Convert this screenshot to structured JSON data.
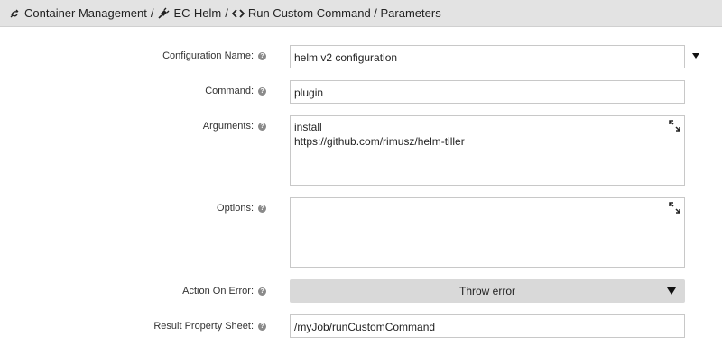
{
  "breadcrumb": {
    "items": [
      {
        "label": "Container Management",
        "icon": "plug-outline-icon"
      },
      {
        "label": "EC-Helm",
        "icon": "plug-icon"
      },
      {
        "label": "Run Custom Command / Parameters",
        "icon": "diamond-arrows-icon"
      }
    ],
    "separator": "/"
  },
  "form": {
    "config_name": {
      "label": "Configuration Name:",
      "value": "helm v2 configuration"
    },
    "command": {
      "label": "Command:",
      "value": "plugin"
    },
    "arguments": {
      "label": "Arguments:",
      "value": "install\nhttps://github.com/rimusz/helm-tiller"
    },
    "options": {
      "label": "Options:",
      "value": ""
    },
    "action_on_error": {
      "label": "Action On Error:",
      "value": "Throw error"
    },
    "result_property_sheet": {
      "label": "Result Property Sheet:",
      "value": "/myJob/runCustomCommand"
    }
  },
  "help_glyph": "?"
}
